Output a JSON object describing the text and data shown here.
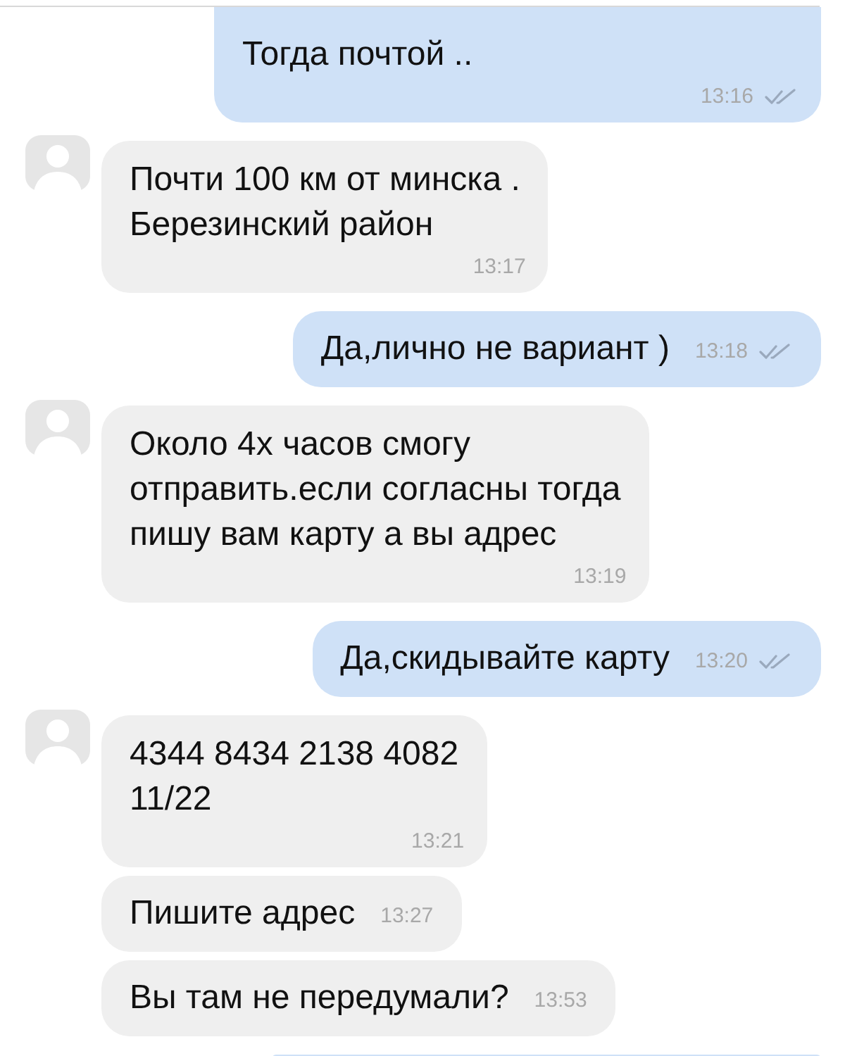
{
  "messages": [
    {
      "outgoing": true,
      "cut_top": true,
      "kind": "stacked",
      "text": "Тогда почтой ..",
      "time": "13:16",
      "read": true
    },
    {
      "outgoing": false,
      "avatar": true,
      "kind": "stacked",
      "text": "Почти 100 км от минска .\nБерезинский район",
      "time": "13:17"
    },
    {
      "outgoing": true,
      "kind": "inline",
      "text": "Да,лично не вариант )",
      "time": "13:18",
      "read": true
    },
    {
      "outgoing": false,
      "avatar": true,
      "kind": "stacked",
      "text": "Около 4х часов смогу\nотправить.если согласны тогда\nпишу вам карту а вы адрес",
      "time": "13:19"
    },
    {
      "outgoing": true,
      "kind": "inline",
      "text": "Да,скидывайте карту",
      "time": "13:20",
      "read": true
    },
    {
      "outgoing": false,
      "avatar": true,
      "kind": "stacked",
      "text": "4344 8434 2138 4082\n11/22",
      "time": "13:21"
    },
    {
      "outgoing": false,
      "avatar": false,
      "kind": "inline",
      "text": "Пишите адрес",
      "time": "13:27"
    },
    {
      "outgoing": false,
      "avatar": false,
      "kind": "inline",
      "text": "Вы там не передумали?",
      "time": "13:53"
    },
    {
      "outgoing": true,
      "kind": "empty",
      "cut_bottom": true
    }
  ]
}
